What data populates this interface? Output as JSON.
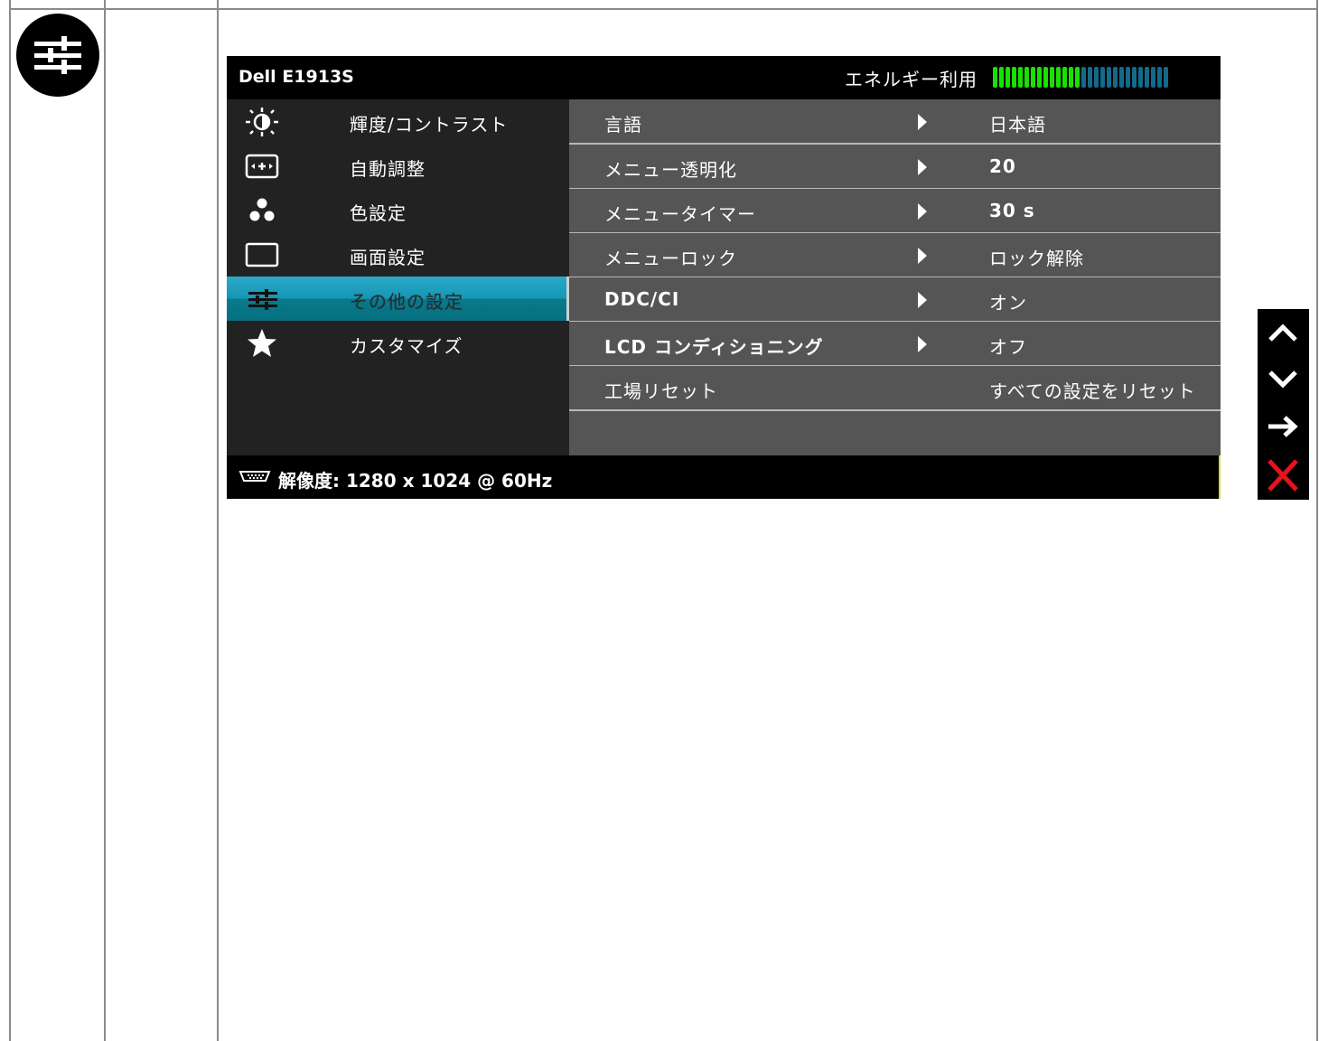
{
  "osd": {
    "model": "Dell E1913S",
    "energy_label": "エネルギー利用",
    "energy_level": 0.5,
    "energy_colors": {
      "active": "#19e000",
      "inactive": "#136a8a"
    },
    "menu": [
      {
        "label": "輝度/コントラスト",
        "icon": "brightness-icon"
      },
      {
        "label": "自動調整",
        "icon": "auto-adjust-icon"
      },
      {
        "label": "色設定",
        "icon": "color-settings-icon"
      },
      {
        "label": "画面設定",
        "icon": "display-settings-icon"
      },
      {
        "label": "その他の設定",
        "icon": "other-settings-icon",
        "selected": true
      },
      {
        "label": "カスタマイズ",
        "icon": "star-icon"
      }
    ],
    "options": [
      {
        "label": "言語",
        "value": "日本語"
      },
      {
        "label": "メニュー透明化",
        "value": "20"
      },
      {
        "label": "メニュータイマー",
        "value": "30 s"
      },
      {
        "label": "メニューロック",
        "value": "ロック解除"
      },
      {
        "label": "DDC/CI",
        "value": "オン"
      },
      {
        "label": "LCD コンディショニング",
        "value": "オフ"
      },
      {
        "label": "工場リセット",
        "value": "すべての設定をリセット"
      }
    ],
    "footer": {
      "resolution_text": "解像度: 1280 x 1024 @ 60Hz",
      "icon": "vga-connector-icon"
    }
  },
  "side_nav": {
    "buttons": [
      "up-icon",
      "down-icon",
      "right-arrow-icon",
      "close-icon"
    ],
    "close_color": "#e8121c"
  },
  "doc_icon": "other-settings-icon"
}
